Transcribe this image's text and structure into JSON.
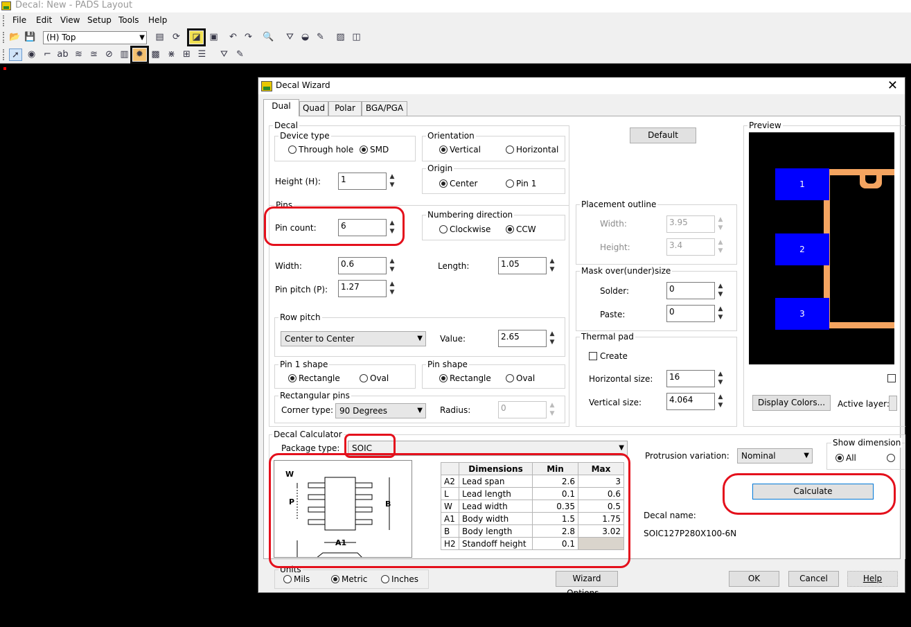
{
  "window": {
    "title": "Decal: New - PADS Layout"
  },
  "menu": [
    "File",
    "Edit",
    "View",
    "Setup",
    "Tools",
    "Help"
  ],
  "toolbar": {
    "layer": "(H) Top"
  },
  "dialog": {
    "title": "Decal Wizard",
    "close": "✕",
    "tabs": [
      "Dual",
      "Quad",
      "Polar",
      "BGA/PGA"
    ],
    "decal": {
      "label": "Decal",
      "device_type": {
        "label": "Device type",
        "options": [
          "Through hole",
          "SMD"
        ],
        "selected": "SMD"
      },
      "orientation": {
        "label": "Orientation",
        "options": [
          "Vertical",
          "Horizontal"
        ],
        "selected": "Vertical"
      },
      "origin": {
        "label": "Origin",
        "options": [
          "Center",
          "Pin 1"
        ],
        "selected": "Center"
      },
      "height_label": "Height (H):",
      "height": "1"
    },
    "default_button": "Default",
    "pins": {
      "label": "Pins",
      "pin_count_label": "Pin count:",
      "pin_count": "6",
      "numbering": {
        "label": "Numbering direction",
        "options": [
          "Clockwise",
          "CCW"
        ],
        "selected": "CCW"
      },
      "width_label": "Width:",
      "width": "0.6",
      "length_label": "Length:",
      "length": "1.05",
      "pitch_label": "Pin pitch (P):",
      "pitch": "1.27",
      "row_pitch": {
        "label": "Row pitch",
        "mode": "Center to Center",
        "value_label": "Value:",
        "value": "2.65"
      },
      "pin1_shape": {
        "label": "Pin 1 shape",
        "options": [
          "Rectangle",
          "Oval"
        ],
        "selected": "Rectangle"
      },
      "pin_shape": {
        "label": "Pin shape",
        "options": [
          "Rectangle",
          "Oval"
        ],
        "selected": "Rectangle"
      },
      "rect_pins": {
        "label": "Rectangular pins",
        "corner_label": "Corner type:",
        "corner": "90 Degrees",
        "radius_label": "Radius:",
        "radius": "0"
      }
    },
    "placement": {
      "label": "Placement outline",
      "width_label": "Width:",
      "width": "3.95",
      "height_label": "Height:",
      "height": "3.4"
    },
    "mask": {
      "label": "Mask over(under)size",
      "solder_label": "Solder:",
      "solder": "0",
      "paste_label": "Paste:",
      "paste": "0"
    },
    "thermal": {
      "label": "Thermal pad",
      "create_label": "Create",
      "create": false,
      "h_label": "Horizontal size:",
      "h": "16",
      "v_label": "Vertical size:",
      "v": "4.064"
    },
    "preview": {
      "label": "Preview",
      "pads": [
        "1",
        "2",
        "3"
      ],
      "display_colors": "Display Colors...",
      "active_layer_label": "Active layer:",
      "pad_color": "#0000ff",
      "outline_color": "#f4a460"
    },
    "calculator": {
      "label": "Decal Calculator",
      "package_label": "Package type:",
      "package": "SOIC",
      "diagram_labels": [
        "W",
        "P",
        "B",
        "A1"
      ],
      "table_headers": [
        "",
        "Dimensions",
        "Min",
        "Max"
      ],
      "rows": [
        {
          "code": "A2",
          "name": "Lead span",
          "min": "2.6",
          "max": "3"
        },
        {
          "code": "L",
          "name": "Lead length",
          "min": "0.1",
          "max": "0.6"
        },
        {
          "code": "W",
          "name": "Lead width",
          "min": "0.35",
          "max": "0.5"
        },
        {
          "code": "A1",
          "name": "Body width",
          "min": "1.5",
          "max": "1.75"
        },
        {
          "code": "B",
          "name": "Body length",
          "min": "2.8",
          "max": "3.02"
        },
        {
          "code": "H2",
          "name": "Standoff height",
          "min": "0.1",
          "max": ""
        }
      ],
      "protrusion_label": "Protrusion variation:",
      "protrusion": "Nominal",
      "show_dim_label": "Show dimension",
      "show_dim_option": "All",
      "calculate": "Calculate",
      "decal_name_label": "Decal name:",
      "decal_name": "SOIC127P280X100-6N"
    },
    "units": {
      "label": "Units",
      "options": [
        "Mils",
        "Metric",
        "Inches"
      ],
      "selected": "Metric"
    },
    "buttons": {
      "wizard_options": "Wizard Options...",
      "ok": "OK",
      "cancel": "Cancel",
      "help": "Help"
    }
  }
}
